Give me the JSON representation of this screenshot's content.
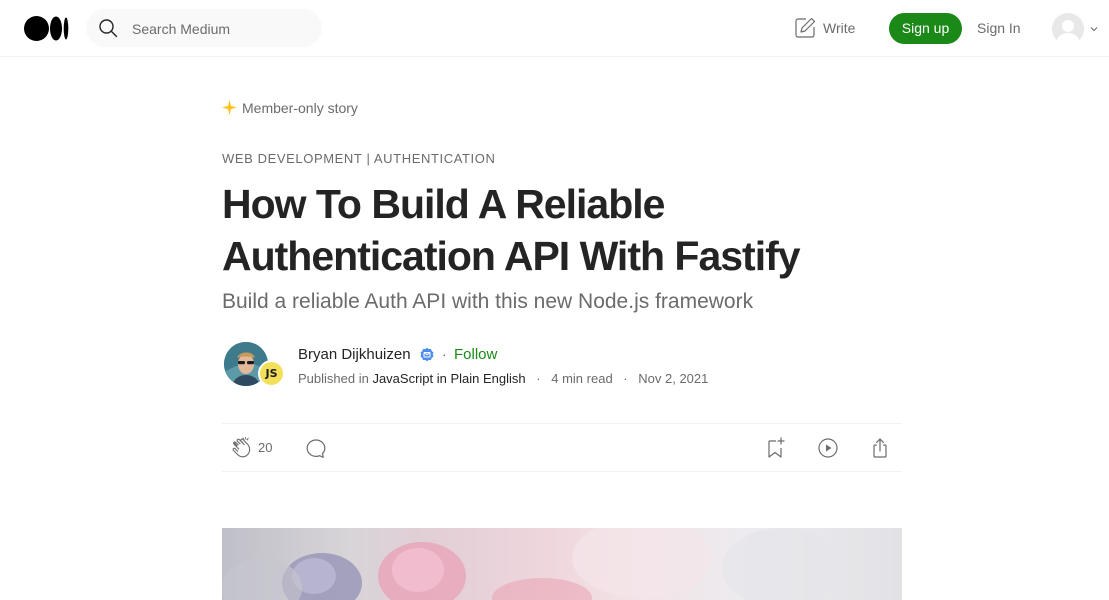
{
  "header": {
    "search_placeholder": "Search Medium",
    "write_label": "Write",
    "signup_label": "Sign up",
    "signin_label": "Sign In"
  },
  "article": {
    "member_label": "Member-only story",
    "kicker": "WEB DEVELOPMENT | AUTHENTICATION",
    "title": "How To Build A Reliable Authentication API With Fastify",
    "subtitle": "Build a reliable Auth API with this new Node.js framework",
    "author": {
      "name": "Bryan Dijkhuizen",
      "follow_label": "Follow",
      "publication_badge": "JS",
      "published_in_label": "Published in",
      "publication": "JavaScript in Plain English",
      "read_time": "4 min read",
      "date": "Nov 2, 2021"
    },
    "clap_count": "20"
  },
  "colors": {
    "accent_green": "#1a8917",
    "text_primary": "#242424",
    "text_secondary": "#6b6b6b",
    "member_star": "#ffc017",
    "verified_badge": "#4a8cf0"
  },
  "icons": {
    "logo": "medium-logo",
    "search": "search-icon",
    "write": "write-icon",
    "clap": "clap-icon",
    "comment": "comment-icon",
    "bookmark": "bookmark-add-icon",
    "listen": "play-icon",
    "share": "share-icon"
  }
}
